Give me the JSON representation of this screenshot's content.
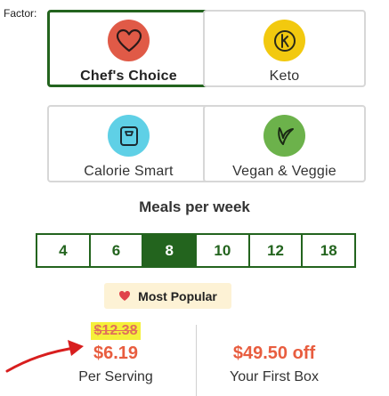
{
  "brand": "Factor:",
  "plans": [
    {
      "name": "Chef's Choice",
      "icon": "heart-icon",
      "icon_bg": "#e05a47",
      "selected": true
    },
    {
      "name": "Keto",
      "icon": "keto-k-icon",
      "icon_bg": "#f2c90f",
      "selected": false
    },
    {
      "name": "Calorie Smart",
      "icon": "scale-icon",
      "icon_bg": "#5fd0e6",
      "selected": false
    },
    {
      "name": "Vegan & Veggie",
      "icon": "leaf-icon",
      "icon_bg": "#6cb24b",
      "selected": false
    }
  ],
  "meals": {
    "title": "Meals per week",
    "options": [
      "4",
      "6",
      "8",
      "10",
      "12",
      "18"
    ],
    "selected": "8"
  },
  "badge": {
    "label": "Most Popular",
    "icon": "heart-icon"
  },
  "pricing": {
    "old_price": "$12.38",
    "price": "$6.19",
    "price_label": "Per Serving",
    "discount": "$49.50 off",
    "discount_label": "Your First Box"
  },
  "colors": {
    "accent_green": "#23641e",
    "price_red": "#e85d3f",
    "highlight": "#f5f03a",
    "badge_bg": "#fdf2d5"
  }
}
